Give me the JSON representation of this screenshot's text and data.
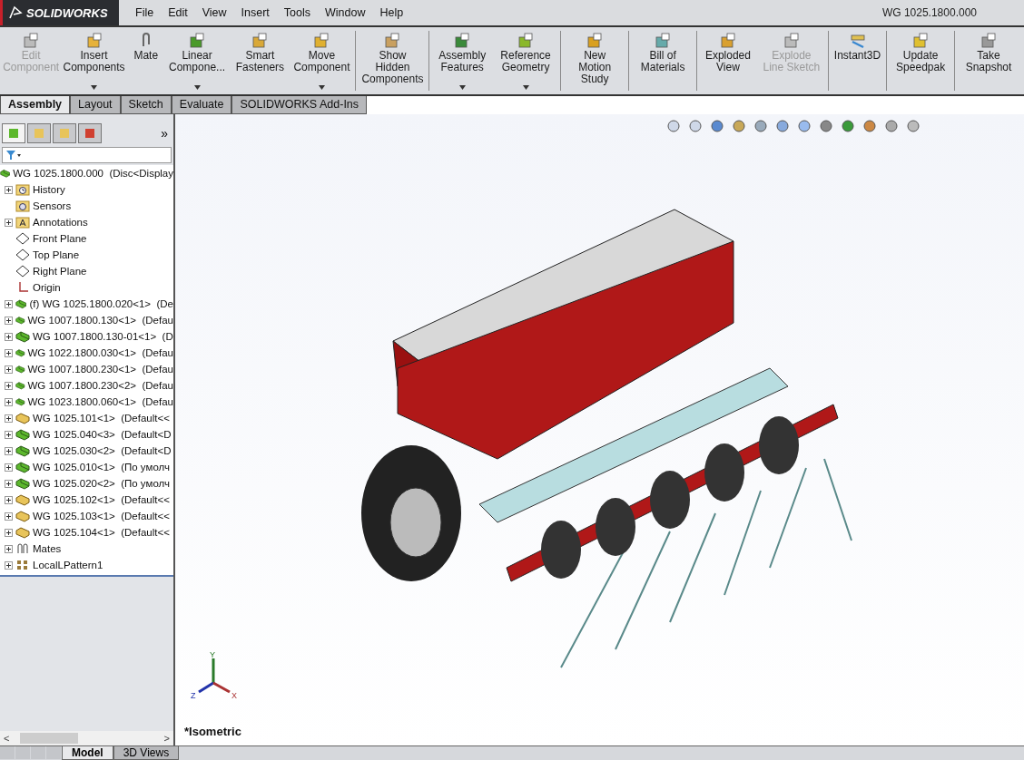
{
  "app": {
    "logo": "SOLIDWORKS",
    "document_title": "WG 1025.1800.000"
  },
  "menu": [
    "File",
    "Edit",
    "View",
    "Insert",
    "Tools",
    "Window",
    "Help"
  ],
  "ribbon_groups": [
    [
      {
        "label": "Edit Component",
        "kind": "edit",
        "disabled": true,
        "dropdown": false
      },
      {
        "label": "Insert Components",
        "kind": "insert",
        "disabled": false,
        "dropdown": true
      },
      {
        "label": "Mate",
        "kind": "mate",
        "disabled": false,
        "dropdown": false
      },
      {
        "label": "Linear Compone...",
        "kind": "pattern",
        "disabled": false,
        "dropdown": true
      },
      {
        "label": "Smart Fasteners",
        "kind": "fastener",
        "disabled": false,
        "dropdown": false
      },
      {
        "label": "Move Component",
        "kind": "move",
        "disabled": false,
        "dropdown": true
      }
    ],
    [
      {
        "label": "Show Hidden Components",
        "kind": "hidden",
        "disabled": false,
        "dropdown": false
      }
    ],
    [
      {
        "label": "Assembly Features",
        "kind": "features",
        "disabled": false,
        "dropdown": true
      },
      {
        "label": "Reference Geometry",
        "kind": "reference",
        "disabled": false,
        "dropdown": true
      }
    ],
    [
      {
        "label": "New Motion Study",
        "kind": "motion",
        "disabled": false,
        "dropdown": false
      }
    ],
    [
      {
        "label": "Bill of Materials",
        "kind": "bom",
        "disabled": false,
        "dropdown": false
      }
    ],
    [
      {
        "label": "Exploded View",
        "kind": "explode",
        "disabled": false,
        "dropdown": false
      },
      {
        "label": "Explode Line Sketch",
        "kind": "explode",
        "disabled": true,
        "dropdown": false
      }
    ],
    [
      {
        "label": "Instant3D",
        "kind": "instant",
        "disabled": false,
        "dropdown": false
      }
    ],
    [
      {
        "label": "Update Speedpak",
        "kind": "speedpak",
        "disabled": false,
        "dropdown": false
      }
    ],
    [
      {
        "label": "Take Snapshot",
        "kind": "snapshot",
        "disabled": false,
        "dropdown": false
      }
    ]
  ],
  "tabs": [
    {
      "label": "Assembly",
      "selected": true
    },
    {
      "label": "Layout",
      "selected": false
    },
    {
      "label": "Sketch",
      "selected": false
    },
    {
      "label": "Evaluate",
      "selected": false
    },
    {
      "label": "SOLIDWORKS Add-Ins",
      "selected": false
    }
  ],
  "tree": {
    "root": "WG 1025.1800.000  (Disc<Display",
    "items": [
      {
        "label": "History",
        "kind": "history",
        "expandable": true
      },
      {
        "label": "Sensors",
        "kind": "sensors",
        "expandable": false
      },
      {
        "label": "Annotations",
        "kind": "annotations",
        "expandable": true
      },
      {
        "label": "Front Plane",
        "kind": "plane",
        "expandable": false
      },
      {
        "label": "Top Plane",
        "kind": "plane",
        "expandable": false
      },
      {
        "label": "Right Plane",
        "kind": "plane",
        "expandable": false
      },
      {
        "label": "Origin",
        "kind": "origin",
        "expandable": false
      },
      {
        "label": "(f) WG 1025.1800.020<1>  (De",
        "kind": "assembly",
        "expandable": true
      },
      {
        "label": "WG 1007.1800.130<1>  (Defau",
        "kind": "assembly",
        "expandable": true
      },
      {
        "label": "WG 1007.1800.130-01<1>  (D",
        "kind": "assembly",
        "expandable": true
      },
      {
        "label": "WG 1022.1800.030<1>  (Defau",
        "kind": "assembly",
        "expandable": true
      },
      {
        "label": "WG 1007.1800.230<1>  (Defau",
        "kind": "assembly",
        "expandable": true
      },
      {
        "label": "WG 1007.1800.230<2>  (Defau",
        "kind": "assembly",
        "expandable": true
      },
      {
        "label": "WG 1023.1800.060<1>  (Defau",
        "kind": "assembly",
        "expandable": true
      },
      {
        "label": "WG 1025.101<1>  (Default<<",
        "kind": "part",
        "expandable": true
      },
      {
        "label": "WG 1025.040<3>  (Default<D",
        "kind": "assembly",
        "expandable": true
      },
      {
        "label": "WG 1025.030<2>  (Default<D",
        "kind": "assembly",
        "expandable": true
      },
      {
        "label": "WG 1025.010<1>  (По умолч",
        "kind": "assembly",
        "expandable": true
      },
      {
        "label": "WG 1025.020<2>  (По умолч",
        "kind": "assembly",
        "expandable": true
      },
      {
        "label": "WG 1025.102<1>  (Default<<",
        "kind": "part",
        "expandable": true
      },
      {
        "label": "WG 1025.103<1>  (Default<<",
        "kind": "part",
        "expandable": true
      },
      {
        "label": "WG 1025.104<1>  (Default<<",
        "kind": "part",
        "expandable": true
      },
      {
        "label": "Mates",
        "kind": "mates",
        "expandable": true
      },
      {
        "label": "LocalLPattern1",
        "kind": "pattern",
        "expandable": true
      }
    ]
  },
  "panel_tabs": [
    {
      "label": "Model",
      "selected": true
    },
    {
      "label": "3D Views",
      "selected": false
    }
  ],
  "panel_expand": "»",
  "scroll_left": "<",
  "scroll_right": ">",
  "view": {
    "name": "*Isometric",
    "axes": {
      "x": "X",
      "y": "Y",
      "z": "Z"
    }
  }
}
